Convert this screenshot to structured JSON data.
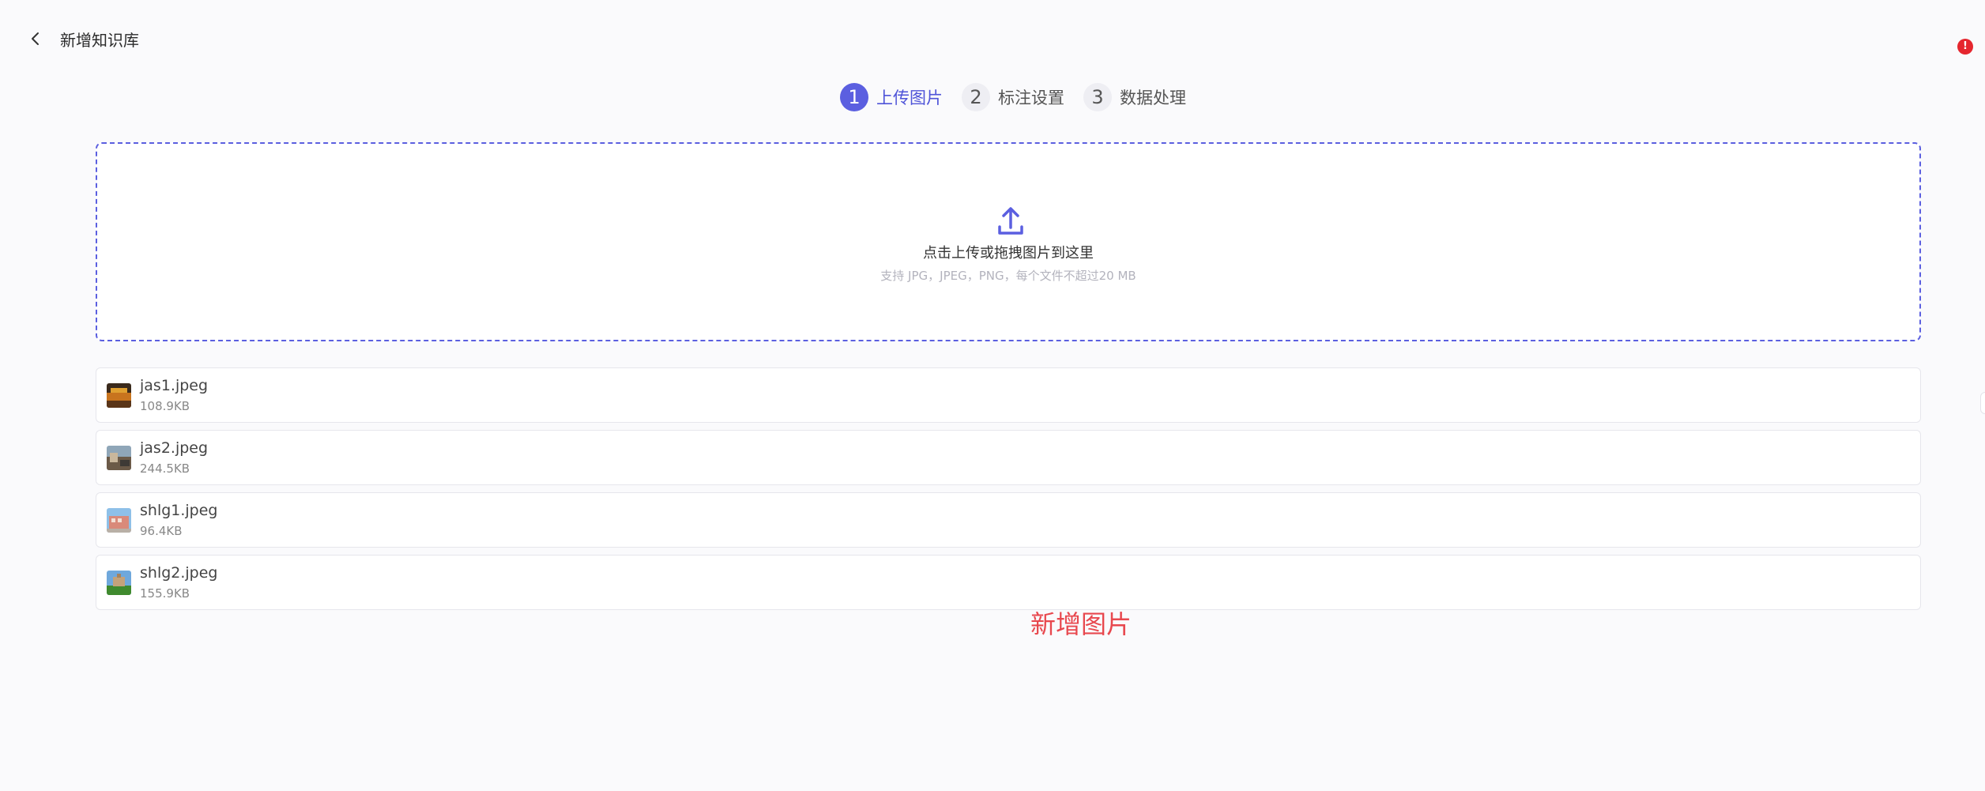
{
  "header": {
    "title": "新增知识库",
    "back_icon": "chevron-left-icon",
    "alert_badge": "!"
  },
  "stepper": {
    "steps": [
      {
        "number": "1",
        "label": "上传图片",
        "active": true
      },
      {
        "number": "2",
        "label": "标注设置",
        "active": false
      },
      {
        "number": "3",
        "label": "数据处理",
        "active": false
      }
    ]
  },
  "dropzone": {
    "icon": "upload-icon",
    "title": "点击上传或拖拽图片到这里",
    "hint": "支持 JPG，JPEG，PNG，每个文件不超过20 MB"
  },
  "files": [
    {
      "name": "jas1.jpeg",
      "size": "108.9KB"
    },
    {
      "name": "jas2.jpeg",
      "size": "244.5KB"
    },
    {
      "name": "shlg1.jpeg",
      "size": "96.4KB"
    },
    {
      "name": "shlg2.jpeg",
      "size": "155.9KB"
    }
  ],
  "overlay_note": "新增图片",
  "colors": {
    "accent": "#5b5fe0",
    "note": "#e8484e",
    "badge": "#e5262e"
  }
}
